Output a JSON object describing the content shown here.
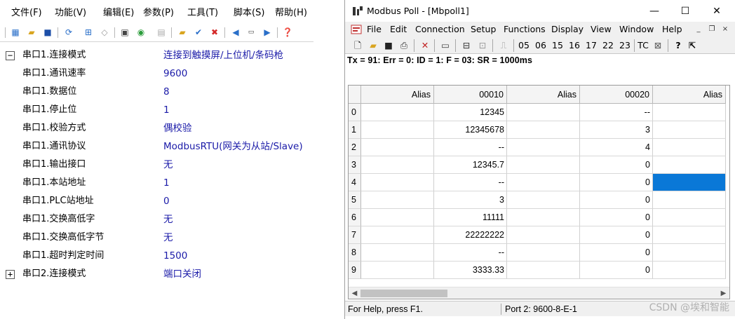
{
  "left": {
    "menu": [
      "文件(F)",
      "功能(V)",
      "编辑(E)",
      "参数(P)",
      "工具(T)",
      "脚本(S)",
      "帮助(H)"
    ],
    "rows": [
      {
        "name": "串口1.连接模式",
        "value": "连接到触摸屏/上位机/条码枪",
        "toggle": "−"
      },
      {
        "name": "串口1.通讯速率",
        "value": "9600"
      },
      {
        "name": "串口1.数据位",
        "value": "8"
      },
      {
        "name": "串口1.停止位",
        "value": "1"
      },
      {
        "name": "串口1.校验方式",
        "value": "偶校验"
      },
      {
        "name": "串口1.通讯协议",
        "value": "ModbusRTU(网关为从站/Slave)"
      },
      {
        "name": "串口1.输出接口",
        "value": "无"
      },
      {
        "name": "串口1.本站地址",
        "value": "1"
      },
      {
        "name": "串口1.PLC站地址",
        "value": "0"
      },
      {
        "name": "串口1.交换高低字",
        "value": "无"
      },
      {
        "name": "串口1.交换高低字节",
        "value": "无"
      },
      {
        "name": "串口1.超时判定时间",
        "value": "1500"
      },
      {
        "name": "串口2.连接模式",
        "value": "端口关闭",
        "toggle": "+"
      }
    ]
  },
  "modbus": {
    "title": "Modbus Poll - [Mbpoll1]",
    "window_buttons": [
      "—",
      "☐",
      "✕"
    ],
    "menu": [
      "File",
      "Edit",
      "Connection",
      "Setup",
      "Functions",
      "Display",
      "View",
      "Window",
      "Help"
    ],
    "mdi_buttons": [
      "_",
      "❐",
      "×"
    ],
    "toolbar_codes": [
      "05",
      "06",
      "15",
      "16",
      "17",
      "22",
      "23"
    ],
    "toolbar_tc": "TC",
    "status_line": "Tx = 91: Err = 0: ID = 1: F = 03: SR = 1000ms",
    "columns": [
      "Alias",
      "00010",
      "Alias",
      "00020",
      "Alias"
    ],
    "rows": [
      {
        "idx": "0",
        "v1": "12345",
        "v2": "--"
      },
      {
        "idx": "1",
        "v1": "12345678",
        "v2": "3"
      },
      {
        "idx": "2",
        "v1": "--",
        "v2": "4"
      },
      {
        "idx": "3",
        "v1": "12345.7",
        "v2": "0"
      },
      {
        "idx": "4",
        "v1": "--",
        "v2": "0"
      },
      {
        "idx": "5",
        "v1": "3",
        "v2": "0"
      },
      {
        "idx": "6",
        "v1": "11111",
        "v2": "0"
      },
      {
        "idx": "7",
        "v1": "22222222",
        "v2": "0"
      },
      {
        "idx": "8",
        "v1": "--",
        "v2": "0"
      },
      {
        "idx": "9",
        "v1": "3333.33",
        "v2": "0"
      }
    ],
    "selected_row": 4,
    "status_help": "For Help, press F1.",
    "status_port": "Port 2: 9600-8-E-1",
    "accent": "#0a78d7"
  },
  "watermark": "CSDN @埃和智能"
}
